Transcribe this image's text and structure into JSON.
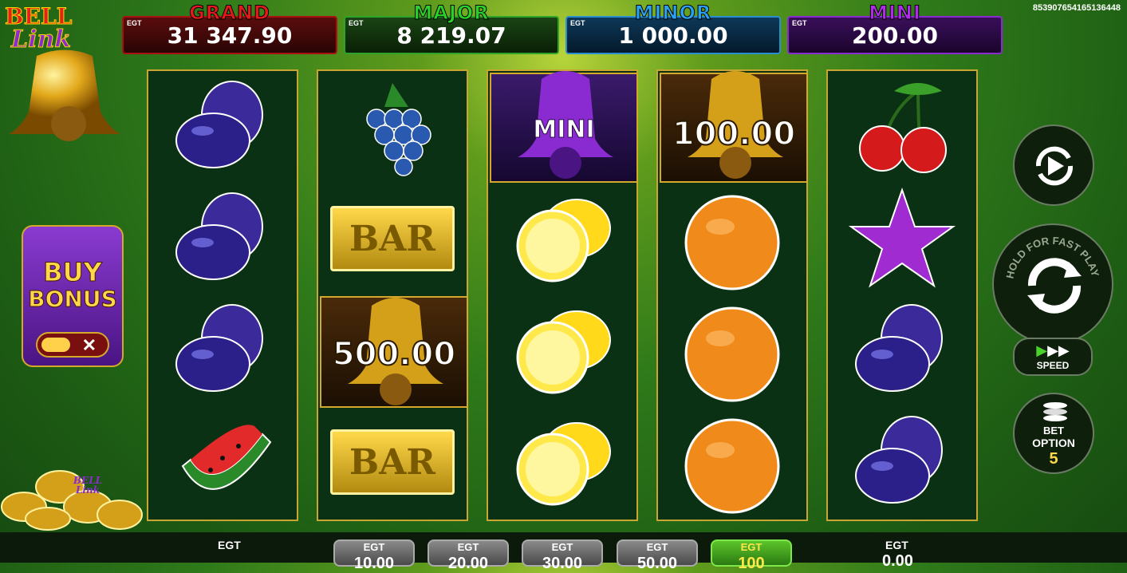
{
  "logo": {
    "line1": "BELL",
    "line2": "Link"
  },
  "session_id": "853907654165136448",
  "jackpots": [
    {
      "name": "GRAND",
      "provider": "EGT",
      "value": "31 347.90"
    },
    {
      "name": "MAJOR",
      "provider": "EGT",
      "value": "8 219.07"
    },
    {
      "name": "MINOR",
      "provider": "EGT",
      "value": "1 000.00"
    },
    {
      "name": "MINI",
      "provider": "EGT",
      "value": "200.00"
    }
  ],
  "reels": {
    "bell_mini_label": "MINI",
    "bell_100": "100.00",
    "bell_500": "500.00",
    "bar_label": "BAR"
  },
  "buy_bonus": {
    "line1": "BUY",
    "line2": "BONUS",
    "toggle_x": "✕"
  },
  "controls": {
    "hold_text": "HOLD FOR FAST PLAY",
    "speed_label": "SPEED",
    "bet_option_line1": "BET",
    "bet_option_line2": "OPTION",
    "bet_option_value": "5"
  },
  "coins_text": "BELL Link",
  "bottom": {
    "left_label": "EGT",
    "right_label": "EGT",
    "right_value": "0.00",
    "bets": [
      {
        "provider": "EGT",
        "value": "10.00"
      },
      {
        "provider": "EGT",
        "value": "20.00"
      },
      {
        "provider": "EGT",
        "value": "30.00"
      },
      {
        "provider": "EGT",
        "value": "50.00"
      },
      {
        "provider": "EGT",
        "value": "100",
        "selected": true
      }
    ]
  },
  "colors": {
    "grand": "#e21a1a",
    "major": "#2bd12b",
    "minor": "#2ba0ef",
    "mini": "#b02be9",
    "reel_border": "#c8a631"
  }
}
